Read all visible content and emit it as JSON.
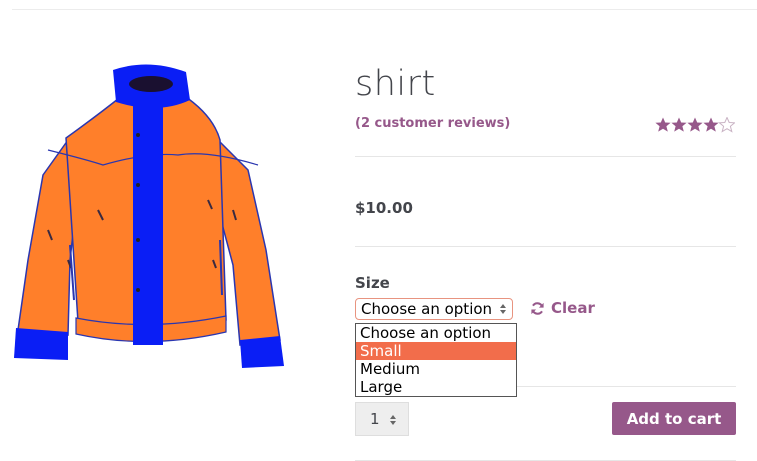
{
  "product": {
    "title": "shirt",
    "reviews_link": "(2 customer reviews)",
    "rating": 4.5,
    "rating_max": 5,
    "price": "$10.00",
    "image": "jacket-illustration"
  },
  "variation": {
    "label": "Size",
    "selected": "Choose an option",
    "options": [
      "Choose an option",
      "Small",
      "Medium",
      "Large"
    ],
    "highlighted_option": "Small",
    "clear_label": "Clear"
  },
  "cart": {
    "quantity": "1",
    "add_to_cart_label": "Add to cart"
  },
  "colors": {
    "accent": "#96588a",
    "highlight": "#f26d4b",
    "jacket_body": "#ff7f2a",
    "jacket_trim": "#0a1ef5"
  }
}
